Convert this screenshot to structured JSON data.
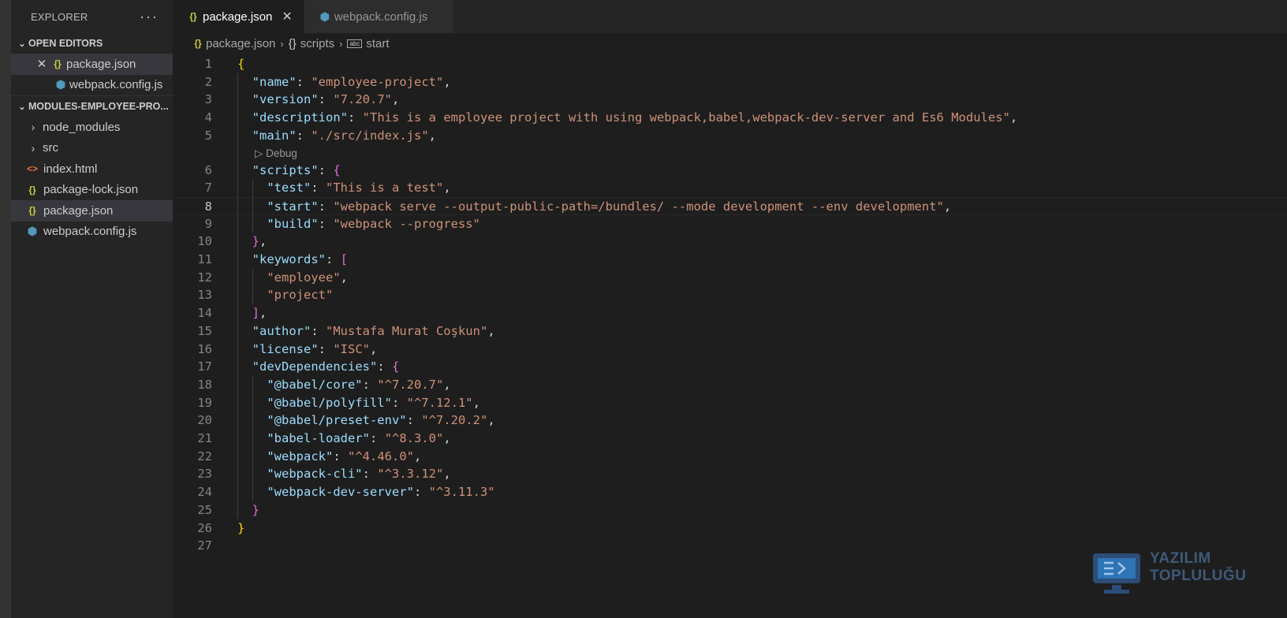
{
  "sidebar": {
    "title": "EXPLORER",
    "more_actions": "···",
    "open_editors": {
      "header": "OPEN EDITORS",
      "items": [
        {
          "name": "package.json",
          "icon": "json-icon",
          "selected": true
        },
        {
          "name": "webpack.config.js",
          "icon": "webpack-icon"
        }
      ]
    },
    "project": {
      "header": "MODULES-EMPLOYEE-PRO...",
      "items": [
        {
          "name": "node_modules",
          "type": "folder"
        },
        {
          "name": "src",
          "type": "folder"
        },
        {
          "name": "index.html",
          "icon": "html-icon"
        },
        {
          "name": "package-lock.json",
          "icon": "json-icon"
        },
        {
          "name": "package.json",
          "icon": "json-icon",
          "selected": true
        },
        {
          "name": "webpack.config.js",
          "icon": "webpack-icon"
        }
      ]
    }
  },
  "tabs": [
    {
      "label": "package.json",
      "icon": "json-icon",
      "active": true,
      "close": "✕"
    },
    {
      "label": "webpack.config.js",
      "icon": "webpack-icon",
      "active": false
    }
  ],
  "breadcrumb": {
    "file": "package.json",
    "obj": "scripts",
    "prop": "start",
    "obj_glyph": "{}",
    "prop_glyph": "abc"
  },
  "editor": {
    "current_line": 8,
    "codelens": {
      "after_line": 5,
      "label": "Debug"
    },
    "lines": [
      {
        "n": 1,
        "t": [
          [
            "b1",
            "{"
          ]
        ]
      },
      {
        "n": 2,
        "t": [
          [
            "p",
            "  "
          ],
          [
            "k",
            "\"name\""
          ],
          [
            "p",
            ": "
          ],
          [
            "s",
            "\"employee-project\""
          ],
          [
            "p",
            ","
          ]
        ]
      },
      {
        "n": 3,
        "t": [
          [
            "p",
            "  "
          ],
          [
            "k",
            "\"version\""
          ],
          [
            "p",
            ": "
          ],
          [
            "s",
            "\"7.20.7\""
          ],
          [
            "p",
            ","
          ]
        ]
      },
      {
        "n": 4,
        "t": [
          [
            "p",
            "  "
          ],
          [
            "k",
            "\"description\""
          ],
          [
            "p",
            ": "
          ],
          [
            "s",
            "\"This is a employee project with using webpack,babel,webpack-dev-server and Es6 Modules\""
          ],
          [
            "p",
            ","
          ]
        ]
      },
      {
        "n": 5,
        "t": [
          [
            "p",
            "  "
          ],
          [
            "k",
            "\"main\""
          ],
          [
            "p",
            ": "
          ],
          [
            "s",
            "\"./src/index.js\""
          ],
          [
            "p",
            ","
          ]
        ]
      },
      {
        "n": 6,
        "t": [
          [
            "p",
            "  "
          ],
          [
            "k",
            "\"scripts\""
          ],
          [
            "p",
            ": "
          ],
          [
            "b2",
            "{"
          ]
        ]
      },
      {
        "n": 7,
        "t": [
          [
            "p",
            "    "
          ],
          [
            "k",
            "\"test\""
          ],
          [
            "p",
            ": "
          ],
          [
            "s",
            "\"This is a test\""
          ],
          [
            "p",
            ","
          ]
        ]
      },
      {
        "n": 8,
        "t": [
          [
            "p",
            "    "
          ],
          [
            "k",
            "\"start\""
          ],
          [
            "p",
            ": "
          ],
          [
            "s",
            "\"webpack serve --output-public-path=/bundles/ --mode development --env development\""
          ],
          [
            "p",
            ","
          ]
        ]
      },
      {
        "n": 9,
        "t": [
          [
            "p",
            "    "
          ],
          [
            "k",
            "\"build\""
          ],
          [
            "p",
            ": "
          ],
          [
            "s",
            "\"webpack --progress\""
          ]
        ]
      },
      {
        "n": 10,
        "t": [
          [
            "p",
            "  "
          ],
          [
            "b2",
            "}"
          ],
          [
            "p",
            ","
          ]
        ]
      },
      {
        "n": 11,
        "t": [
          [
            "p",
            "  "
          ],
          [
            "k",
            "\"keywords\""
          ],
          [
            "p",
            ": "
          ],
          [
            "b2",
            "["
          ]
        ]
      },
      {
        "n": 12,
        "t": [
          [
            "p",
            "    "
          ],
          [
            "s",
            "\"employee\""
          ],
          [
            "p",
            ","
          ]
        ]
      },
      {
        "n": 13,
        "t": [
          [
            "p",
            "    "
          ],
          [
            "s",
            "\"project\""
          ]
        ]
      },
      {
        "n": 14,
        "t": [
          [
            "p",
            "  "
          ],
          [
            "b2",
            "]"
          ],
          [
            "p",
            ","
          ]
        ]
      },
      {
        "n": 15,
        "t": [
          [
            "p",
            "  "
          ],
          [
            "k",
            "\"author\""
          ],
          [
            "p",
            ": "
          ],
          [
            "s",
            "\"Mustafa Murat Coşkun\""
          ],
          [
            "p",
            ","
          ]
        ]
      },
      {
        "n": 16,
        "t": [
          [
            "p",
            "  "
          ],
          [
            "k",
            "\"license\""
          ],
          [
            "p",
            ": "
          ],
          [
            "s",
            "\"ISC\""
          ],
          [
            "p",
            ","
          ]
        ]
      },
      {
        "n": 17,
        "t": [
          [
            "p",
            "  "
          ],
          [
            "k",
            "\"devDependencies\""
          ],
          [
            "p",
            ": "
          ],
          [
            "b2",
            "{"
          ]
        ]
      },
      {
        "n": 18,
        "t": [
          [
            "p",
            "    "
          ],
          [
            "k",
            "\"@babel/core\""
          ],
          [
            "p",
            ": "
          ],
          [
            "s",
            "\"^7.20.7\""
          ],
          [
            "p",
            ","
          ]
        ]
      },
      {
        "n": 19,
        "t": [
          [
            "p",
            "    "
          ],
          [
            "k",
            "\"@babel/polyfill\""
          ],
          [
            "p",
            ": "
          ],
          [
            "s",
            "\"^7.12.1\""
          ],
          [
            "p",
            ","
          ]
        ]
      },
      {
        "n": 20,
        "t": [
          [
            "p",
            "    "
          ],
          [
            "k",
            "\"@babel/preset-env\""
          ],
          [
            "p",
            ": "
          ],
          [
            "s",
            "\"^7.20.2\""
          ],
          [
            "p",
            ","
          ]
        ]
      },
      {
        "n": 21,
        "t": [
          [
            "p",
            "    "
          ],
          [
            "k",
            "\"babel-loader\""
          ],
          [
            "p",
            ": "
          ],
          [
            "s",
            "\"^8.3.0\""
          ],
          [
            "p",
            ","
          ]
        ]
      },
      {
        "n": 22,
        "t": [
          [
            "p",
            "    "
          ],
          [
            "k",
            "\"webpack\""
          ],
          [
            "p",
            ": "
          ],
          [
            "s",
            "\"^4.46.0\""
          ],
          [
            "p",
            ","
          ]
        ]
      },
      {
        "n": 23,
        "t": [
          [
            "p",
            "    "
          ],
          [
            "k",
            "\"webpack-cli\""
          ],
          [
            "p",
            ": "
          ],
          [
            "s",
            "\"^3.3.12\""
          ],
          [
            "p",
            ","
          ]
        ]
      },
      {
        "n": 24,
        "t": [
          [
            "p",
            "    "
          ],
          [
            "k",
            "\"webpack-dev-server\""
          ],
          [
            "p",
            ": "
          ],
          [
            "s",
            "\"^3.11.3\""
          ]
        ]
      },
      {
        "n": 25,
        "t": [
          [
            "p",
            "  "
          ],
          [
            "b2",
            "}"
          ]
        ]
      },
      {
        "n": 26,
        "t": [
          [
            "b1",
            "}"
          ]
        ]
      },
      {
        "n": 27,
        "t": []
      }
    ]
  },
  "watermark": {
    "line1": "YAZILIM",
    "line2": "TOPLULUĞU"
  }
}
